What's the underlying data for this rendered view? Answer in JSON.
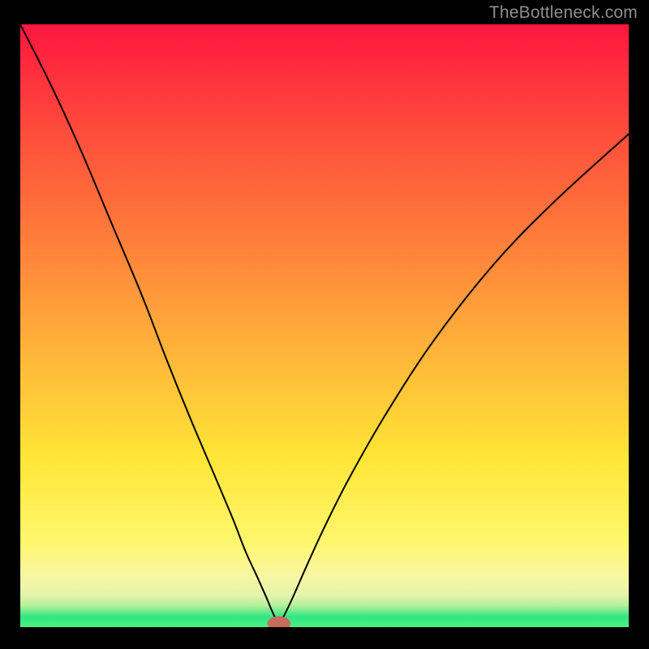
{
  "watermark": "TheBottleneck.com",
  "chart_data": {
    "type": "line",
    "title": "",
    "xlabel": "",
    "ylabel": "",
    "xlim": [
      0,
      100
    ],
    "ylim": [
      0,
      100
    ],
    "grid": false,
    "legend": false,
    "bands": [
      {
        "name": "green",
        "y0": 0,
        "y1": 2.8,
        "color_top": "#19e37a",
        "color_bottom": "#4ff087"
      },
      {
        "name": "pale",
        "y0": 2.8,
        "y1": 6.5,
        "color_top": "#c9f29a",
        "color_bottom": "#f1f6b3"
      },
      {
        "name": "yellow",
        "y0": 6.5,
        "y1": 14,
        "color_top": "#f7f3a0",
        "color_bottom": "#fff76d"
      },
      {
        "name": "orange",
        "y0": 15,
        "y1": 60,
        "color_top": "#fff239",
        "color_bottom": "#ff8a3a"
      },
      {
        "name": "red",
        "y0": 60,
        "y1": 100,
        "color_top": "#ff7a36",
        "color_bottom": "#ff163f"
      }
    ],
    "series": [
      {
        "name": "bottleneck-curve",
        "color": "#000000",
        "x_min": 42.5,
        "x": [
          0,
          5,
          10,
          15,
          20,
          24,
          28,
          32,
          35,
          37,
          39,
          40.5,
          41.5,
          42.5,
          43.5,
          45,
          47,
          50,
          54,
          60,
          68,
          78,
          88,
          100
        ],
        "values": [
          100,
          90,
          79,
          67,
          55,
          44.5,
          34.5,
          25,
          17.8,
          12.6,
          8.2,
          4.8,
          2.4,
          0.6,
          2.2,
          5.4,
          10.0,
          16.6,
          24.6,
          35.2,
          47.6,
          60.4,
          70.8,
          81.8
        ]
      }
    ],
    "marker": {
      "x": 42.5,
      "y": 0.6,
      "color": "#c96a5e",
      "rx": 1.9,
      "ry": 1.2
    }
  }
}
